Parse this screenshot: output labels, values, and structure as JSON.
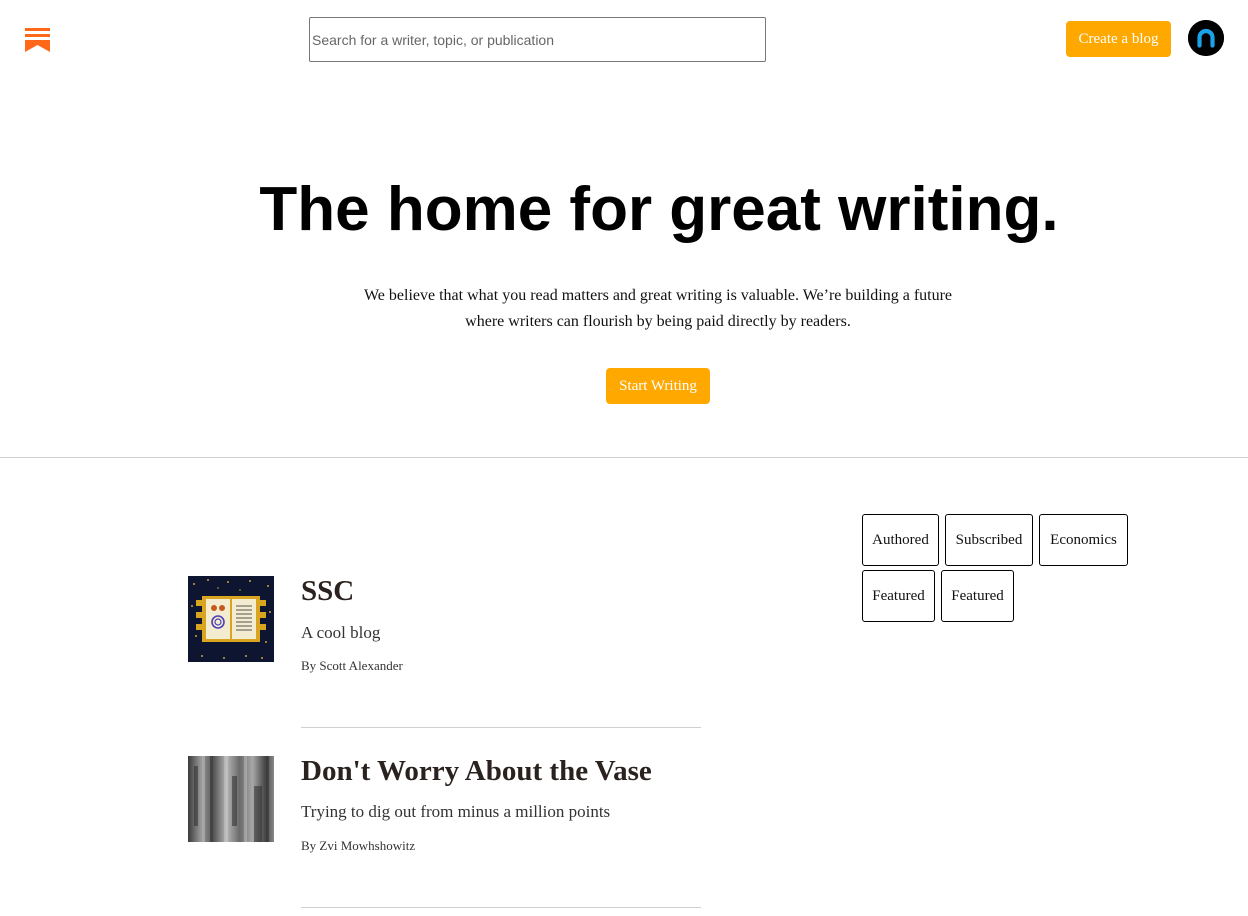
{
  "header": {
    "logo_icon": "substack-bookmark-icon",
    "search": {
      "placeholder": "Search for a writer, topic, or publication",
      "value": ""
    },
    "create_blog_label": "Create a blog",
    "avatar_icon": "user-avatar-icon"
  },
  "hero": {
    "title": "The home for great writing.",
    "description": "We believe that what you read matters and great writing is valuable. We’re building a future where writers can flourish by being paid directly by readers.",
    "cta_label": "Start Writing"
  },
  "filters": {
    "items": [
      "Authored",
      "Subscribed",
      "Economics",
      "Featured",
      "Featured"
    ]
  },
  "blogs": [
    {
      "title": "SSC",
      "description": "A cool blog",
      "author": "By Scott Alexander"
    },
    {
      "title": "Don't Worry About the Vase",
      "description": "Trying to dig out from minus a million points",
      "author": "By Zvi Mowhshowitz"
    }
  ],
  "colors": {
    "accent": "#ffa800",
    "logo": "#ff6719",
    "title_text": "#2a221f"
  }
}
